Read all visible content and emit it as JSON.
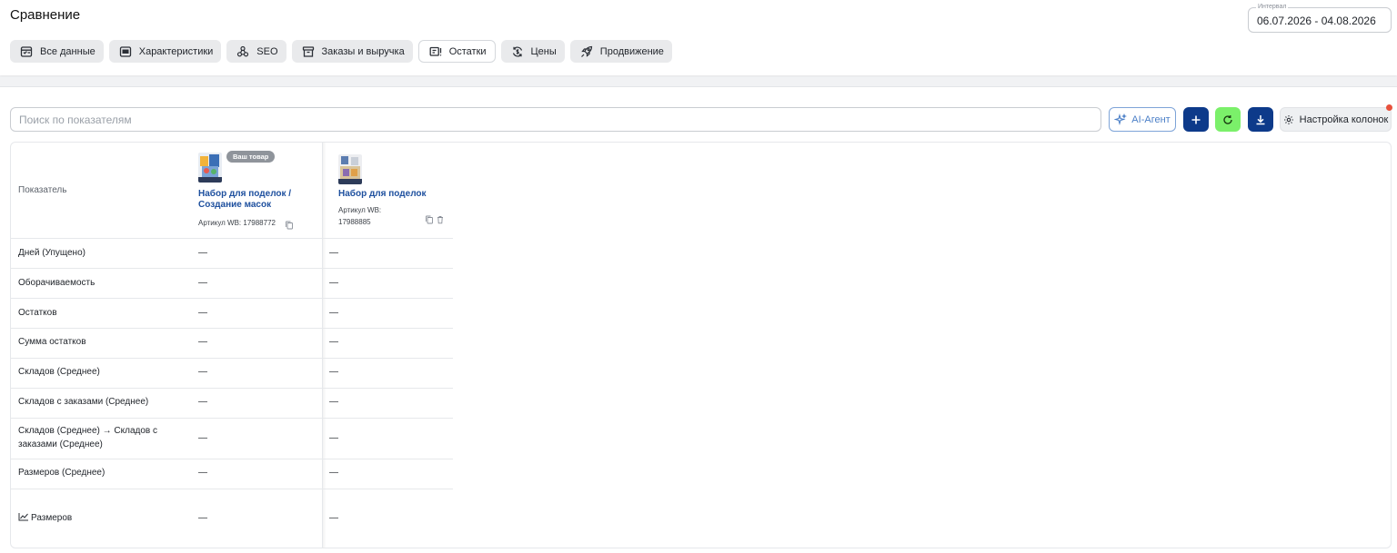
{
  "page": {
    "title": "Сравнение"
  },
  "interval": {
    "label": "Интервал",
    "value": "06.07.2026 - 04.08.2026"
  },
  "tabs": [
    {
      "label": "Все данные",
      "icon": "table-icon",
      "active": false
    },
    {
      "label": "Характеристики",
      "icon": "card-icon",
      "active": false
    },
    {
      "label": "SEO",
      "icon": "molecule-icon",
      "active": false
    },
    {
      "label": "Заказы и выручка",
      "icon": "box-icon",
      "active": false
    },
    {
      "label": "Остатки",
      "icon": "stock-alert-icon",
      "active": true
    },
    {
      "label": "Цены",
      "icon": "price-refresh-icon",
      "active": false
    },
    {
      "label": "Продвижение",
      "icon": "rocket-icon",
      "active": false
    }
  ],
  "toolbar": {
    "search_placeholder": "Поиск по показателям",
    "ai_label": "AI-Агент",
    "columns_label": "Настройка колонок",
    "colors": {
      "primary": "#0d3a8a",
      "refresh": "#7bf06a",
      "notification": "#e8513c"
    }
  },
  "table": {
    "header_label": "Показатель",
    "products": [
      {
        "badge": "Ваш товар",
        "title_line1": "Набор для поделок /",
        "title_line2": "Создание масок",
        "article": "Артикул WB: 17988772"
      },
      {
        "title": "Набор для поделок",
        "article_line1": "Артикул WB:",
        "article_line2": "17988885"
      }
    ],
    "rows": [
      {
        "label": "Дней (Упущено)",
        "values": [
          "—",
          "—"
        ]
      },
      {
        "label": "Оборачиваемость",
        "values": [
          "—",
          "—"
        ]
      },
      {
        "label": "Остатков",
        "values": [
          "—",
          "—"
        ]
      },
      {
        "label": "Сумма остатков",
        "values": [
          "—",
          "—"
        ]
      },
      {
        "label": "Складов (Среднее)",
        "values": [
          "—",
          "—"
        ]
      },
      {
        "label": "Складов с заказами (Среднее)",
        "values": [
          "—",
          "—"
        ]
      },
      {
        "label_line1": "Складов (Среднее) → Складов с",
        "label_line2": "заказами (Среднее)",
        "values": [
          "—",
          "—"
        ]
      },
      {
        "label": "Размеров (Среднее)",
        "values": [
          "—",
          "—"
        ]
      },
      {
        "label": "Размеров",
        "icon": "line-chart-icon",
        "values": [
          "—",
          "—"
        ]
      }
    ]
  }
}
